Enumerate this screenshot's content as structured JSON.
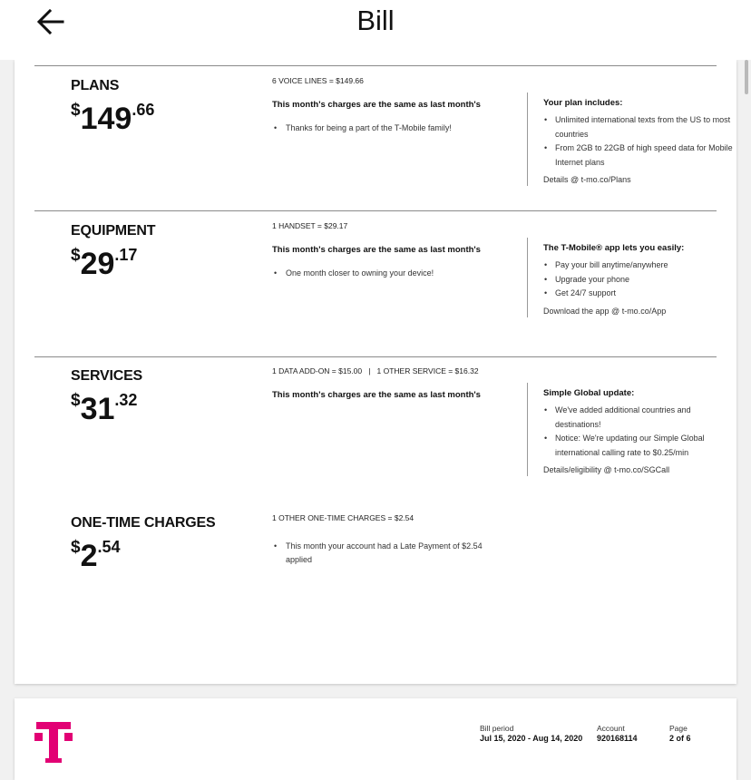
{
  "appbar": {
    "title": "Bill"
  },
  "sections": [
    {
      "name": "PLANS",
      "currency": "$",
      "dollars": "149",
      "cents": ".66",
      "count_text": "6 VOICE LINES = $149.66",
      "same_text": "This month's charges are the same as last month's",
      "bullets": [
        "Thanks for being a part of the T-Mobile family!"
      ],
      "side": {
        "title": "Your plan includes:",
        "items": [
          "Unlimited international texts from the US to most countries",
          "From 2GB to 22GB of high speed data for Mobile Internet plans"
        ],
        "link": "Details @ t-mo.co/Plans"
      }
    },
    {
      "name": "EQUIPMENT",
      "currency": "$",
      "dollars": "29",
      "cents": ".17",
      "count_text": "1 HANDSET = $29.17",
      "same_text": "This month's charges are the same as last month's",
      "bullets": [
        "One month closer to owning your device!"
      ],
      "side": {
        "title": "The T-Mobile® app lets you easily:",
        "items": [
          "Pay your bill anytime/anywhere",
          "Upgrade your phone",
          "Get 24/7 support"
        ],
        "link": "Download the app @ t-mo.co/App"
      }
    },
    {
      "name": "SERVICES",
      "currency": "$",
      "dollars": "31",
      "cents": ".32",
      "count_text": "1 DATA ADD-ON = $15.00   |   1 OTHER SERVICE = $16.32",
      "same_text": "This month's charges are the same as last month's",
      "bullets": [],
      "side": {
        "title": "Simple Global update:",
        "items": [
          "We've added additional countries and destinations!",
          "Notice: We're updating our Simple Global international calling rate to $0.25/min"
        ],
        "link": "Details/eligibility @ t-mo.co/SGCall"
      }
    },
    {
      "name": "ONE-TIME CHARGES",
      "currency": "$",
      "dollars": "2",
      "cents": ".54",
      "count_text": "1 OTHER ONE-TIME CHARGES = $2.54",
      "bullets": [
        "This month your account had a Late Payment of $2.54 applied"
      ]
    }
  ],
  "footer": {
    "bill_period_label": "Bill period",
    "bill_period_value": "Jul 15, 2020 - Aug 14, 2020",
    "account_label": "Account",
    "account_value": "920168114",
    "page_label": "Page",
    "page_value": "2 of 6"
  },
  "colors": {
    "brand": "#e20074",
    "text": "#111111",
    "divider": "#8a8a8a"
  },
  "icons": {
    "back": "arrow-left-icon",
    "logo": "t-mobile-logo-icon"
  }
}
